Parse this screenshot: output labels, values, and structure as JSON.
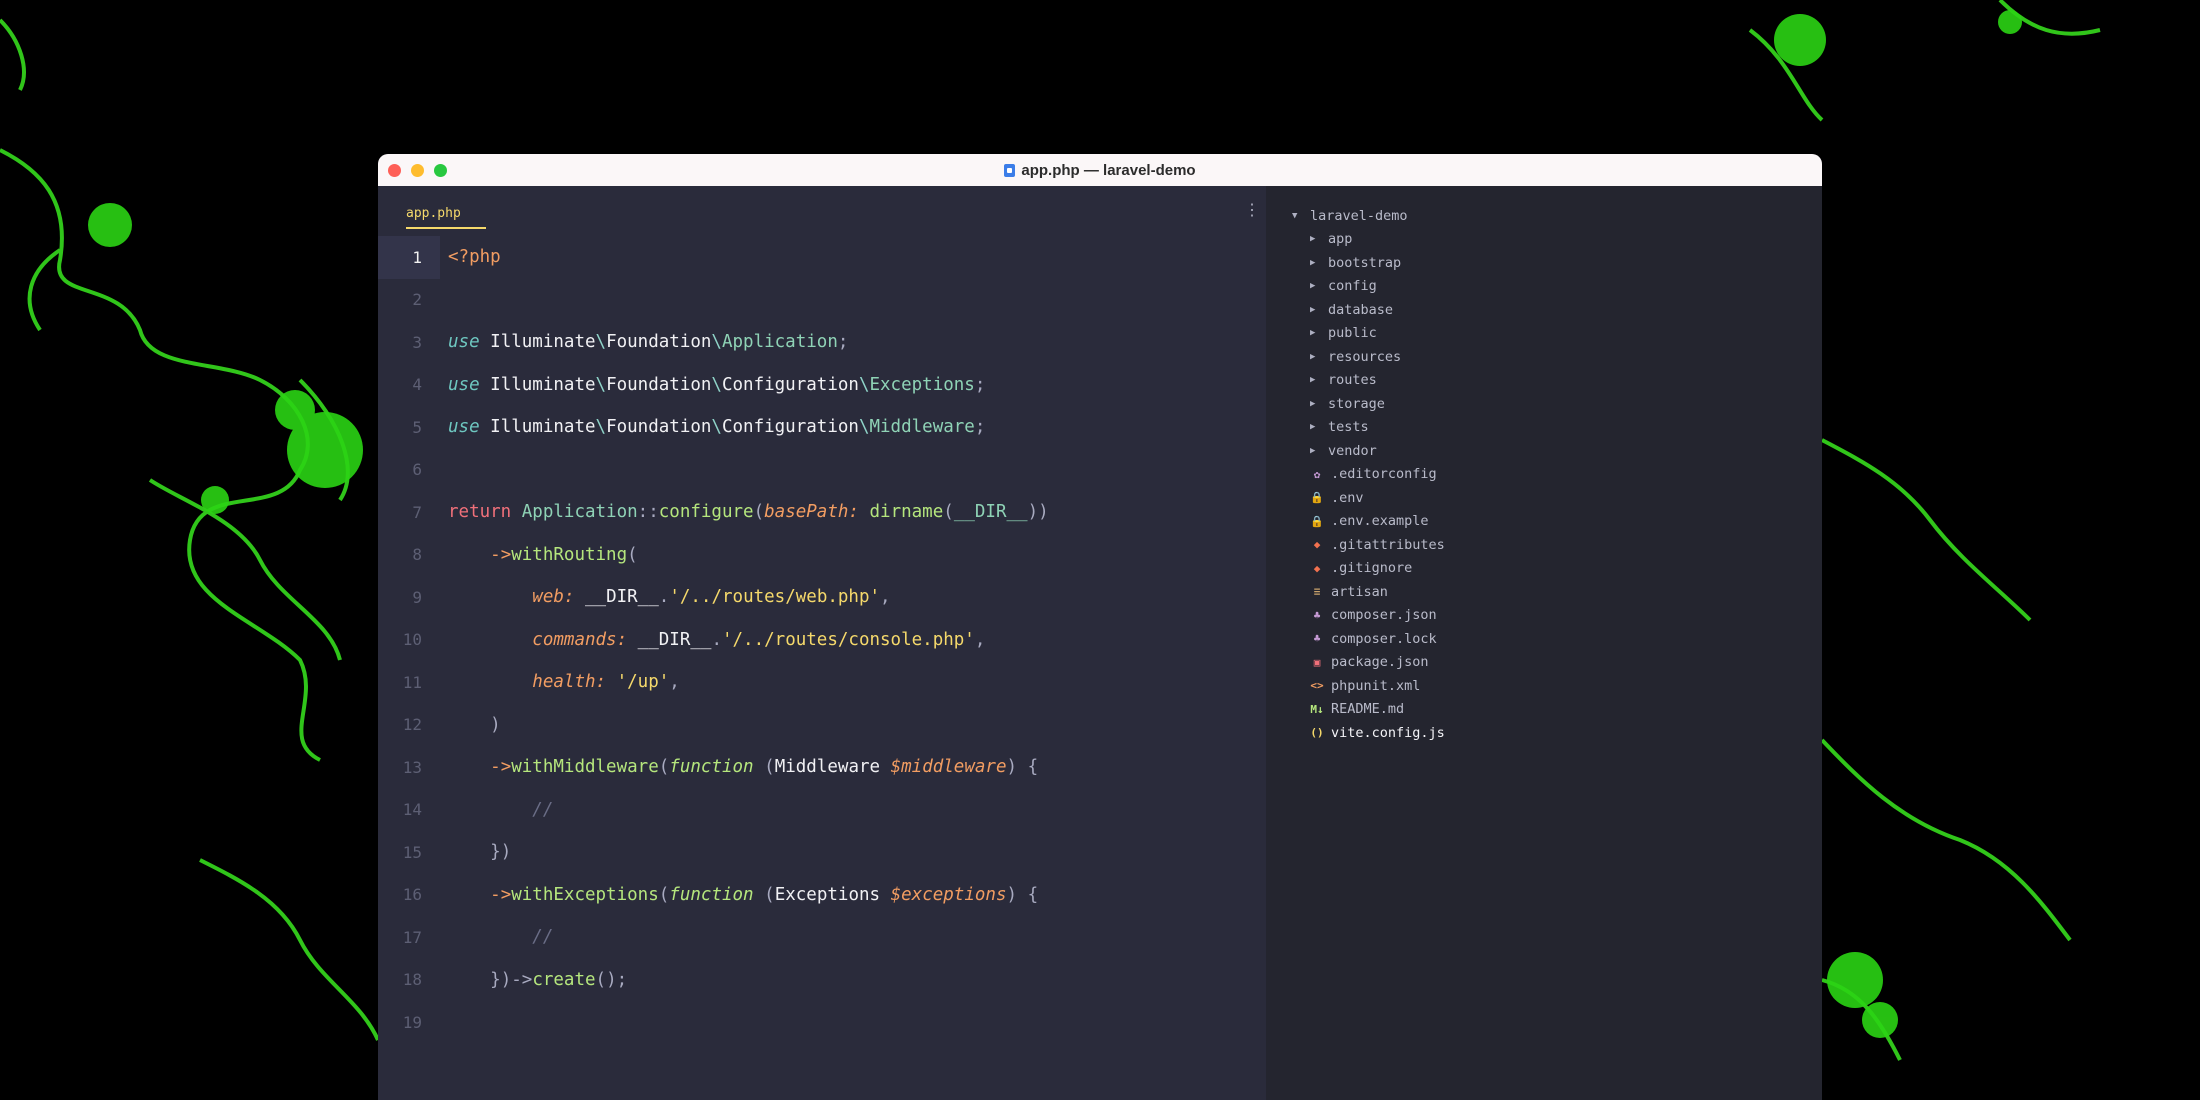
{
  "window": {
    "title": "app.php — laravel-demo"
  },
  "editor": {
    "tab_label": "app.php",
    "menu_glyph": "⋮",
    "line_numbers": [
      "1",
      "2",
      "3",
      "4",
      "5",
      "6",
      "7",
      "8",
      "9",
      "10",
      "11",
      "12",
      "13",
      "14",
      "15",
      "16",
      "17",
      "18",
      "19"
    ],
    "active_line": 1
  },
  "code": {
    "l1_tag": "<?php",
    "l3": {
      "use": "use",
      "ns1": "Illuminate",
      "ns2": "Foundation",
      "cls": "Application",
      "end": ";"
    },
    "l4": {
      "use": "use",
      "ns1": "Illuminate",
      "ns2": "Foundation",
      "ns3": "Configuration",
      "cls": "Exceptions",
      "end": ";"
    },
    "l5": {
      "use": "use",
      "ns1": "Illuminate",
      "ns2": "Foundation",
      "ns3": "Configuration",
      "cls": "Middleware",
      "end": ";"
    },
    "l7": {
      "ret": "return",
      "cls": "Application",
      "sep": "::",
      "fn": "configure",
      "arg": "basePath:",
      "call": "dirname",
      "const": "__DIR__"
    },
    "l8": {
      "arrow": "->",
      "fn": "withRouting"
    },
    "l9": {
      "arg": "web:",
      "const": "__DIR__",
      "str": "'/../routes/web.php'"
    },
    "l10": {
      "arg": "commands:",
      "const": "__DIR__",
      "str": "'/../routes/console.php'"
    },
    "l11": {
      "arg": "health:",
      "str": "'/up'"
    },
    "l13": {
      "arrow": "->",
      "fn": "withMiddleware",
      "kw": "function",
      "type": "Middleware",
      "var": "$middleware"
    },
    "l14": {
      "cmt": "//"
    },
    "l16": {
      "arrow": "->",
      "fn": "withExceptions",
      "kw": "function",
      "type": "Exceptions",
      "var": "$exceptions"
    },
    "l17": {
      "cmt": "//"
    },
    "l18": {
      "fn": "create"
    }
  },
  "tree": {
    "root": "laravel-demo",
    "folders": [
      "app",
      "bootstrap",
      "config",
      "database",
      "public",
      "resources",
      "routes",
      "storage",
      "tests",
      "vendor"
    ],
    "files": [
      {
        "name": ".editorconfig",
        "icon": "gear-icon",
        "glyph": "✿",
        "color": "#c79bd6"
      },
      {
        "name": ".env",
        "icon": "lock-icon",
        "glyph": "🔒",
        "color": "#f5d96b"
      },
      {
        "name": ".env.example",
        "icon": "lock-icon",
        "glyph": "🔒",
        "color": "#f5d96b"
      },
      {
        "name": ".gitattributes",
        "icon": "git-icon",
        "glyph": "◆",
        "color": "#f2714f"
      },
      {
        "name": ".gitignore",
        "icon": "git-icon",
        "glyph": "◆",
        "color": "#f2714f"
      },
      {
        "name": "artisan",
        "icon": "lines-icon",
        "glyph": "≡",
        "color": "#c9a26b"
      },
      {
        "name": "composer.json",
        "icon": "composer-icon",
        "glyph": "♣",
        "color": "#c79bd6"
      },
      {
        "name": "composer.lock",
        "icon": "composer-icon",
        "glyph": "♣",
        "color": "#c79bd6"
      },
      {
        "name": "package.json",
        "icon": "npm-icon",
        "glyph": "▣",
        "color": "#f0707a"
      },
      {
        "name": "phpunit.xml",
        "icon": "code-icon",
        "glyph": "<>",
        "color": "#f29d62"
      },
      {
        "name": "README.md",
        "icon": "markdown-icon",
        "glyph": "M↓",
        "color": "#b5e67d"
      },
      {
        "name": "vite.config.js",
        "icon": "js-icon",
        "glyph": "()",
        "color": "#f5d96b"
      }
    ]
  }
}
